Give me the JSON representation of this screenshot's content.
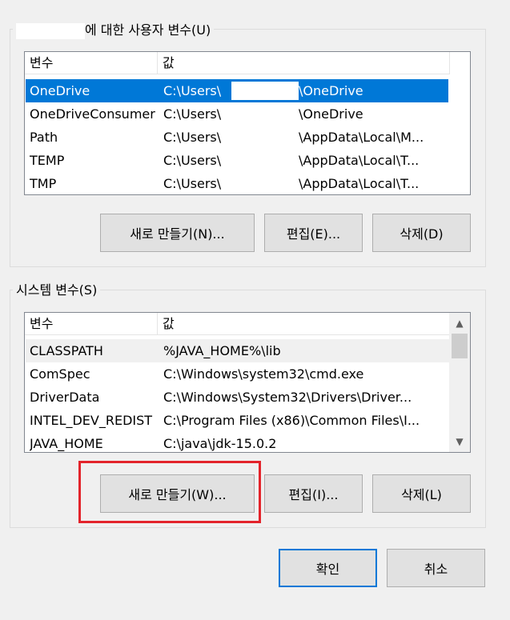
{
  "user_vars": {
    "title_suffix": "에 대한 사용자 변수(U)",
    "col_name": "변수",
    "col_value": "값",
    "rows": [
      {
        "name": "OneDrive",
        "v1": "C:\\Users\\",
        "v2": "\\OneDrive"
      },
      {
        "name": "OneDriveConsumer",
        "v1": "C:\\Users\\",
        "v2": "\\OneDrive"
      },
      {
        "name": "Path",
        "v1": "C:\\Users\\",
        "v2": "\\AppData\\Local\\M..."
      },
      {
        "name": "TEMP",
        "v1": "C:\\Users\\",
        "v2": "\\AppData\\Local\\T..."
      },
      {
        "name": "TMP",
        "v1": "C:\\Users\\",
        "v2": "\\AppData\\Local\\T..."
      }
    ],
    "new_label": "새로 만들기(N)...",
    "edit_label": "편집(E)...",
    "delete_label": "삭제(D)"
  },
  "system_vars": {
    "title": "시스템 변수(S)",
    "col_name": "변수",
    "col_value": "값",
    "rows": [
      {
        "name": "CLASSPATH",
        "value": "%JAVA_HOME%\\lib"
      },
      {
        "name": "ComSpec",
        "value": "C:\\Windows\\system32\\cmd.exe"
      },
      {
        "name": "DriverData",
        "value": "C:\\Windows\\System32\\Drivers\\Driver..."
      },
      {
        "name": "INTEL_DEV_REDIST",
        "value": "C:\\Program Files (x86)\\Common Files\\I..."
      },
      {
        "name": "JAVA_HOME",
        "value": "C:\\java\\jdk-15.0.2"
      }
    ],
    "new_label": "새로 만들기(W)...",
    "edit_label": "편집(I)...",
    "delete_label": "삭제(L)"
  },
  "dialog": {
    "ok_label": "확인",
    "cancel_label": "취소"
  },
  "icons": {
    "scroll_up": "▲",
    "scroll_down": "▼"
  },
  "colors": {
    "selection": "#0078d7",
    "highlight": "#e3242b"
  }
}
